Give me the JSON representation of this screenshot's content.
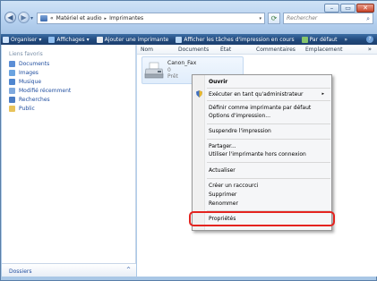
{
  "window": {
    "controls": {
      "minimize": "–",
      "maximize": "▭",
      "close": "✕"
    }
  },
  "nav": {
    "back": "◀",
    "forward": "▶",
    "dropdown": "▾",
    "refresh": "⟳"
  },
  "address": {
    "prefix": "«",
    "segments": [
      "Matériel et audio",
      "Imprimantes"
    ],
    "separator": "▸",
    "dropdown": "▾"
  },
  "search": {
    "placeholder": "Rechercher",
    "icon": "search-icon"
  },
  "toolbar": {
    "items": [
      {
        "label": "Organiser",
        "icon": "organize-icon",
        "color": "#cfe3fb"
      },
      {
        "label": "Affichages",
        "icon": "views-icon",
        "color": "#8fbef0"
      },
      {
        "label": "Ajouter une imprimante",
        "icon": "add-printer-icon",
        "color": "#e8ecf2"
      },
      {
        "label": "Afficher les tâches d'impression en cours",
        "icon": "print-queue-icon",
        "color": "#b9d7f5"
      },
      {
        "label": "Par défaut",
        "icon": "default-printer-icon",
        "color": "#86c46b"
      }
    ],
    "more": "»",
    "help": "?"
  },
  "sidebar": {
    "title": "Liens favoris",
    "items": [
      {
        "label": "Documents",
        "icon": "documents-icon",
        "color": "#5b8ed6"
      },
      {
        "label": "Images",
        "icon": "images-icon",
        "color": "#6aa3e0"
      },
      {
        "label": "Musique",
        "icon": "music-icon",
        "color": "#4f86cf"
      },
      {
        "label": "Modifié récemment",
        "icon": "recent-icon",
        "color": "#7fa9de"
      },
      {
        "label": "Recherches",
        "icon": "searches-icon",
        "color": "#4a7cc4"
      },
      {
        "label": "Public",
        "icon": "public-folder-icon",
        "color": "#e8c35a"
      }
    ],
    "folders": {
      "label": "Dossiers",
      "chevron": "^"
    }
  },
  "list": {
    "columns": [
      "Nom",
      "Documents",
      "État",
      "Commentaires",
      "Emplacement"
    ],
    "more": "»",
    "items": [
      {
        "name": "Canon_Fax",
        "documents": "0",
        "status": "Prêt"
      }
    ]
  },
  "context_menu": {
    "items": [
      {
        "label": "Ouvrir",
        "bold": true
      },
      {
        "separator": true
      },
      {
        "label": "Exécuter en tant qu'administrateur",
        "submenu": "▸",
        "icon": "shield-icon"
      },
      {
        "separator": true
      },
      {
        "label": "Définir comme imprimante par défaut"
      },
      {
        "label": "Options d'impression..."
      },
      {
        "separator": true
      },
      {
        "label": "Suspendre l'impression"
      },
      {
        "separator": true
      },
      {
        "label": "Partager..."
      },
      {
        "label": "Utiliser l'imprimante hors connexion"
      },
      {
        "separator": true
      },
      {
        "label": "Actualiser"
      },
      {
        "separator": true
      },
      {
        "label": "Créer un raccourci"
      },
      {
        "label": "Supprimer"
      },
      {
        "label": "Renommer"
      },
      {
        "separator": true
      },
      {
        "label": "Propriétés"
      }
    ]
  },
  "colors": {
    "toolbar": "#21497c",
    "highlight": "#e4231f",
    "link": "#1e4c9e"
  }
}
